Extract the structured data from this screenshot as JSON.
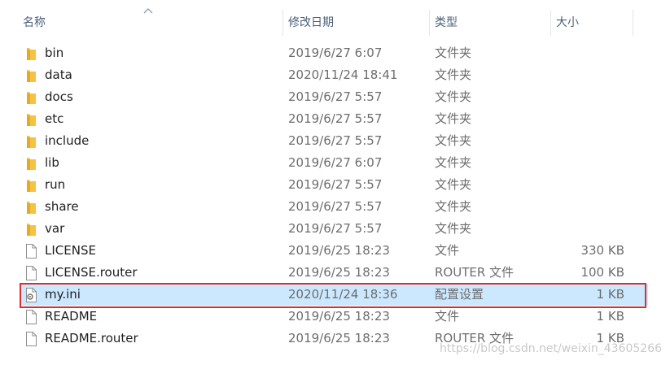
{
  "header": {
    "name_label": "名称",
    "date_label": "修改日期",
    "type_label": "类型",
    "size_label": "大小"
  },
  "rows": [
    {
      "name": "bin",
      "date": "2019/6/27 6:07",
      "type": "文件夹",
      "size": "",
      "icon": "folder-icon"
    },
    {
      "name": "data",
      "date": "2020/11/24 18:41",
      "type": "文件夹",
      "size": "",
      "icon": "folder-icon"
    },
    {
      "name": "docs",
      "date": "2019/6/27 5:57",
      "type": "文件夹",
      "size": "",
      "icon": "folder-icon"
    },
    {
      "name": "etc",
      "date": "2019/6/27 5:57",
      "type": "文件夹",
      "size": "",
      "icon": "folder-icon"
    },
    {
      "name": "include",
      "date": "2019/6/27 5:57",
      "type": "文件夹",
      "size": "",
      "icon": "folder-icon"
    },
    {
      "name": "lib",
      "date": "2019/6/27 6:07",
      "type": "文件夹",
      "size": "",
      "icon": "folder-icon"
    },
    {
      "name": "run",
      "date": "2019/6/27 5:57",
      "type": "文件夹",
      "size": "",
      "icon": "folder-icon"
    },
    {
      "name": "share",
      "date": "2019/6/27 5:57",
      "type": "文件夹",
      "size": "",
      "icon": "folder-icon"
    },
    {
      "name": "var",
      "date": "2019/6/27 5:57",
      "type": "文件夹",
      "size": "",
      "icon": "folder-icon"
    },
    {
      "name": "LICENSE",
      "date": "2019/6/25 18:23",
      "type": "文件",
      "size": "330 KB",
      "icon": "file-icon"
    },
    {
      "name": "LICENSE.router",
      "date": "2019/6/25 18:23",
      "type": "ROUTER 文件",
      "size": "100 KB",
      "icon": "file-icon"
    },
    {
      "name": "my.ini",
      "date": "2020/11/24 18:36",
      "type": "配置设置",
      "size": "1 KB",
      "icon": "settings-file-icon",
      "selected": true
    },
    {
      "name": "README",
      "date": "2019/6/25 18:23",
      "type": "文件",
      "size": "1 KB",
      "icon": "file-icon"
    },
    {
      "name": "README.router",
      "date": "2019/6/25 18:23",
      "type": "ROUTER 文件",
      "size": "1 KB",
      "icon": "file-icon"
    }
  ],
  "watermark": "https://blog.csdn.net/weixin_43605266",
  "colors": {
    "selection": "#cce8ff",
    "highlight_border": "#d9302c",
    "folder": "#f5c242",
    "header_text": "#4c607a"
  }
}
